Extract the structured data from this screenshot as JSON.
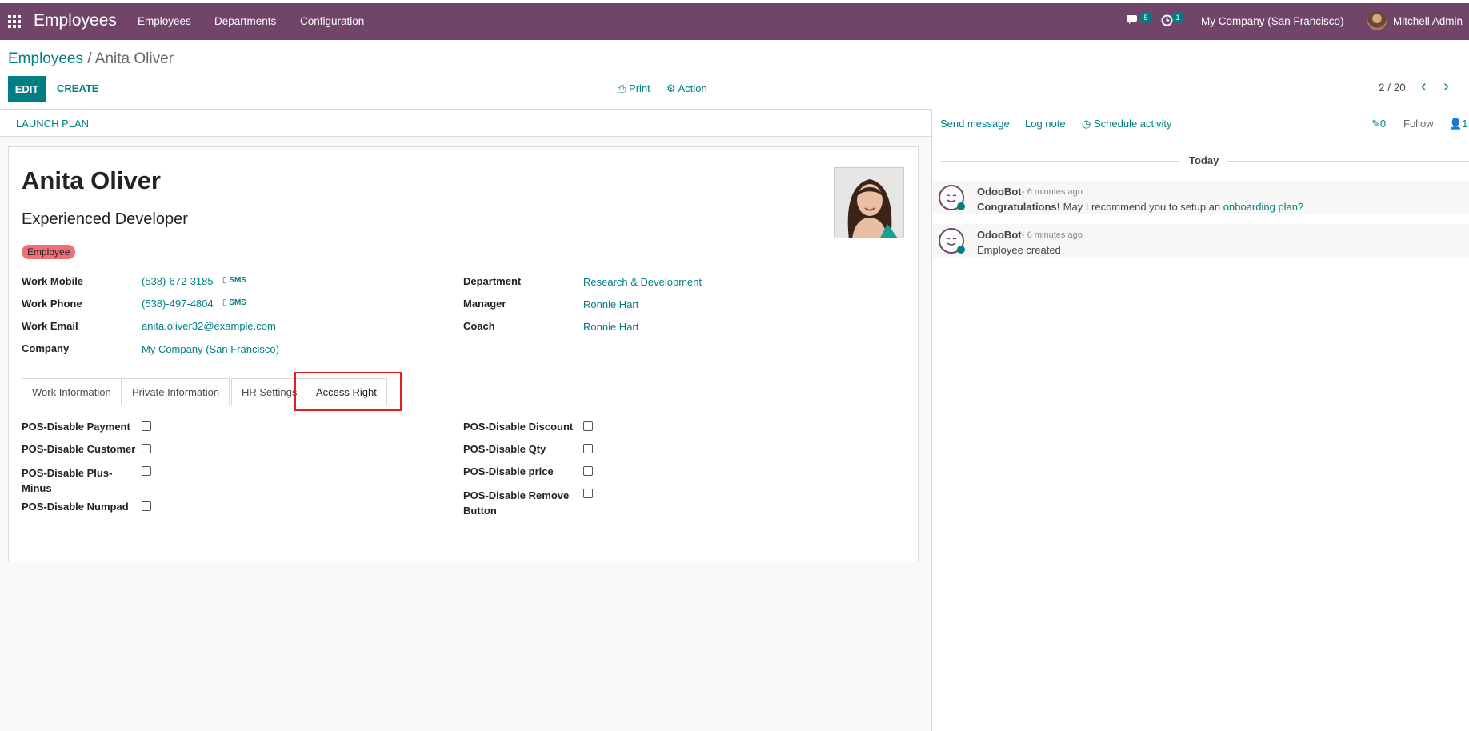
{
  "navbar": {
    "brand": "Employees",
    "menu": [
      "Employees",
      "Departments",
      "Configuration"
    ],
    "messages_badge": "5",
    "activity_badge": "1",
    "company": "My Company (San Francisco)",
    "user": "Mitchell Admin"
  },
  "breadcrumb": {
    "parent": "Employees",
    "current": "Anita Oliver"
  },
  "toolbar": {
    "edit": "EDIT",
    "create": "CREATE",
    "print": "Print",
    "action": "Action",
    "pager": "2 / 20"
  },
  "statusbar": {
    "launch_plan": "LAUNCH PLAN"
  },
  "employee": {
    "name": "Anita Oliver",
    "job_title": "Experienced Developer",
    "tag": "Employee",
    "left_fields": [
      {
        "label": "Work Mobile",
        "value": "(538)-672-3185",
        "sms": "SMS"
      },
      {
        "label": "Work Phone",
        "value": "(538)-497-4804",
        "sms": "SMS"
      },
      {
        "label": "Work Email",
        "value": "anita.oliver32@example.com"
      },
      {
        "label": "Company",
        "value": "My Company (San Francisco)"
      }
    ],
    "right_fields": [
      {
        "label": "Department",
        "value": "Research & Development"
      },
      {
        "label": "Manager",
        "value": "Ronnie Hart"
      },
      {
        "label": "Coach",
        "value": "Ronnie Hart"
      }
    ]
  },
  "tabs": [
    "Work Information",
    "Private Information",
    "HR Settings",
    "Access Right"
  ],
  "active_tab": "Access Right",
  "access_rights": {
    "left": [
      {
        "label": "POS-Disable Payment",
        "checked": false
      },
      {
        "label": "POS-Disable Customer",
        "checked": false
      },
      {
        "label": "POS-Disable Plus-\nMinus",
        "checked": false
      },
      {
        "label": "POS-Disable Numpad",
        "checked": false
      }
    ],
    "right": [
      {
        "label": "POS-Disable Discount",
        "checked": false
      },
      {
        "label": "POS-Disable Qty",
        "checked": false
      },
      {
        "label": "POS-Disable price",
        "checked": false
      },
      {
        "label": "POS-Disable Remove\nButton",
        "checked": false
      }
    ]
  },
  "chatter": {
    "send_message": "Send message",
    "log_note": "Log note",
    "schedule_activity": "Schedule activity",
    "attachments": "0",
    "follow": "Follow",
    "followers": "1",
    "day": "Today",
    "messages": [
      {
        "author": "OdooBot",
        "time": "- 6 minutes ago",
        "strong": "Congratulations!",
        "text": " May I recommend you to setup an ",
        "link": "onboarding plan?"
      },
      {
        "author": "OdooBot",
        "time": "- 6 minutes ago",
        "text": "Employee created"
      }
    ]
  },
  "colors": {
    "navbar": "#71456a",
    "accent": "#017e84",
    "tag": "#f06f77",
    "highlight": "#e41f1f"
  }
}
